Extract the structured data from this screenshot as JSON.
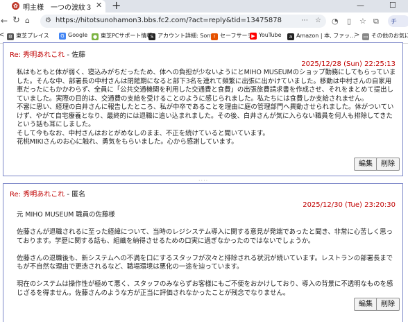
{
  "browser": {
    "tab_title": "明主様　一つの波紋３",
    "url": "https://hitotsunohamon3.bbs.fc2.com/?act=reply&tid=13475878",
    "profile_text": "チ"
  },
  "bookmarks": [
    {
      "label": "東芝プレイス",
      "color": "#555555",
      "glyph": "⚙"
    },
    {
      "label": "Google",
      "color": "#4285f4",
      "glyph": "G"
    },
    {
      "label": "東芝PCサポート情報",
      "color": "#7cb342",
      "glyph": "●"
    },
    {
      "label": "アカウント詳細: Sony...",
      "color": "#222222",
      "glyph": "S"
    },
    {
      "label": "セーフサーチ",
      "color": "#e65100",
      "glyph": "!"
    },
    {
      "label": "YouTube",
      "color": "#ff0000",
      "glyph": "▶"
    },
    {
      "label": "Amazon | 本, ファッ...",
      "color": "#222222",
      "glyph": "a"
    },
    {
      "label": "その他のお気に",
      "color": "#666666",
      "glyph": "▭"
    }
  ],
  "posts": [
    {
      "re_label": "Re: 秀明あれこれ",
      "author": "- 佐藤",
      "date": "2025/12/28 (Sun) 22:25:13",
      "paragraphs": [
        "私はもともと体が弱く、寝込みがちだったため、体への負担が少ないようにとMIHO MUSEUMのショップ勤務にしてもらっていました。そんな中、部署長の中村さんは閉館期になると部下3名を連れて頻繁に出張に出かけていました。移動は中村さんの自家用車だったにもかかわらず、全員に「公共交通機関を利用した交通費と食費」の出張旅費請求書を作成させ、それをまとめて提出していました。実際の目的は、交通費の支給を受けることのように感じられました。私たちには食費しか支給されません。",
        "不審に思い、経理の白井さんに報告したところ、私が中卒であることを理由に庭の管理部門へ異動させられました。体がついていけず、やがて自宅療養となり、最終的には退職に追い込まれました。その後、白井さんが気に入らない職員を何人も排除してきたという話も耳にしました。",
        "そして今もなお、中村さんはおとがめなしのまま、不正を続けていると聞いています。",
        "花桃MIKIさんのお心に触れ、勇気をもらいました。心から感謝しています。"
      ],
      "edit_label": "編集",
      "delete_label": "削除"
    },
    {
      "re_label": "Re: 秀明あれこれ",
      "author": "- 匿名",
      "date": "2025/12/30 (Tue) 23:20:30",
      "paragraphs": [
        "元 MIHO MUSEUM 職員の佐藤様",
        "",
        "佐藤さんが退職されるに至った経緯について、当時のレジシステム導入に関する意見が発端であったと聞き、非常に心苦しく思っております。学歴に関する話も、組織を納得させるための口実に過ぎなかったのではないでしょうか。",
        "",
        "佐藤さんの退職後も、新システムへの不満を口にするスタッフが次々と排除される状況が続いています。レストランの部署長までもが不自然な理由で更迭されるなど、職場環境は悪化の一途を辿っています。",
        "",
        "現在のシステムは操作性が極めて悪く、スタッフのみならずお客様にもご不便をおかけしており、導入の背景に不透明なものを感じざるを得ません。佐藤さんのような方が正当に評価されなかったことが残念でなりません。"
      ],
      "edit_label": "編集",
      "delete_label": "削除"
    }
  ]
}
